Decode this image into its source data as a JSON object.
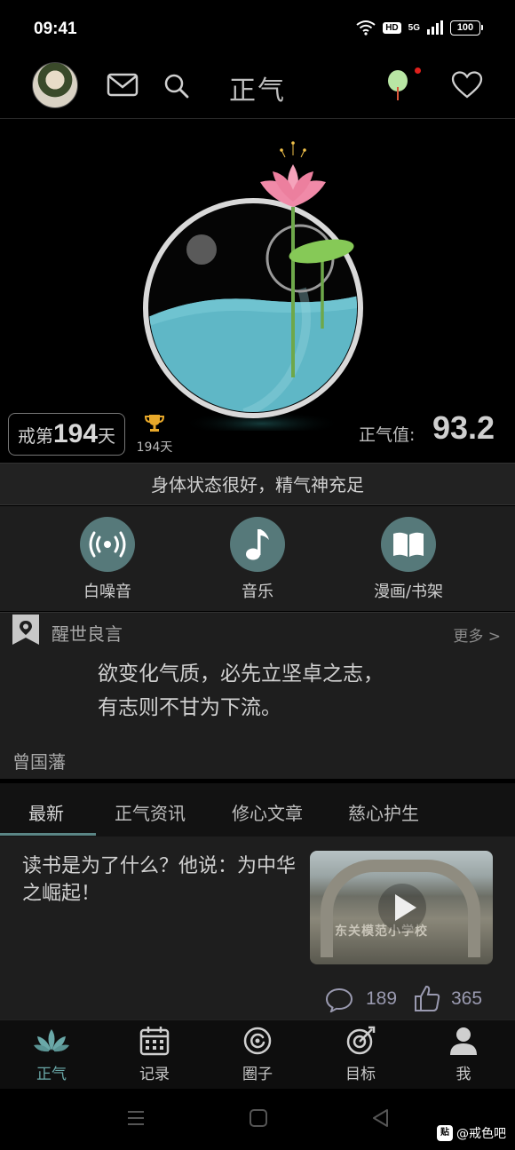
{
  "status_bar": {
    "time": "09:41",
    "hd": "HD",
    "network": "5G",
    "battery": "100"
  },
  "header": {
    "title": "正气"
  },
  "hero": {
    "day_prefix": "戒第",
    "day_count": "194",
    "day_suffix": "天",
    "trophy_days": "194天",
    "qi_label": "正气值:",
    "qi_value": "93.2"
  },
  "status_message": "身体状态很好，精气神充足",
  "tools": [
    {
      "label": "白噪音",
      "icon": "broadcast-icon"
    },
    {
      "label": "音乐",
      "icon": "music-note-icon"
    },
    {
      "label": "漫画/书架",
      "icon": "open-book-icon"
    }
  ],
  "quote": {
    "heading": "醒世良言",
    "more": "更多 >",
    "line1": "欲变化气质，必先立坚卓之志，",
    "line2": "有志则不甘为下流。",
    "author": "曾国藩"
  },
  "tabs": [
    {
      "label": "最新",
      "active": true
    },
    {
      "label": "正气资讯"
    },
    {
      "label": "修心文章"
    },
    {
      "label": "慈心护生"
    }
  ],
  "article": {
    "title": "读书是为了什么？他说：为中华之崛起！",
    "comments": "189",
    "likes": "365",
    "thumb_sign": "东关模范小学校"
  },
  "bottom_nav": [
    {
      "label": "正气",
      "icon": "lotus-icon",
      "active": true
    },
    {
      "label": "记录",
      "icon": "calendar-icon"
    },
    {
      "label": "圈子",
      "icon": "circle-icon"
    },
    {
      "label": "目标",
      "icon": "target-icon"
    },
    {
      "label": "我",
      "icon": "person-icon"
    }
  ],
  "watermark": {
    "badge": "贴",
    "text": "@戒色吧"
  },
  "colors": {
    "accent": "#56797a",
    "water": "#5fb7c6",
    "lotus": "#f08aa8",
    "background": "#000000"
  }
}
